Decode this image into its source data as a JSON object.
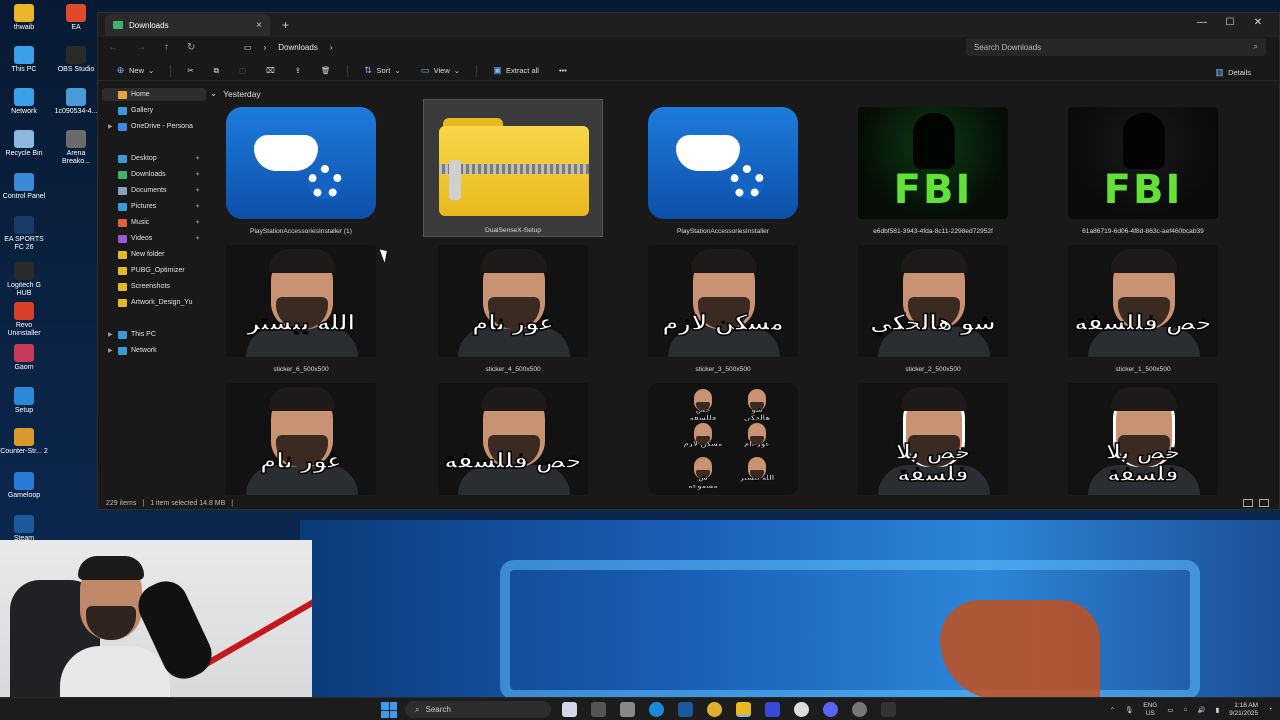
{
  "desktop": {
    "icons": [
      {
        "label": "thwaib",
        "color": "#e9b82a"
      },
      {
        "label": "EA",
        "color": "#e04a2a"
      },
      {
        "label": "This PC",
        "color": "#3aa0e8"
      },
      {
        "label": "OBS Studio",
        "color": "#2a2a2a"
      },
      {
        "label": "Network",
        "color": "#3aa0e8"
      },
      {
        "label": "1c090534-4...",
        "color": "#4a9ad8"
      },
      {
        "label": "Recycle Bin",
        "color": "#8fb8e0"
      },
      {
        "label": "Arena Breako...",
        "color": "#6a6a6a"
      },
      {
        "label": "Control Panel",
        "color": "#3a8ad8"
      },
      {
        "label": "EA SPORTS FC 26",
        "color": "#1a3a6a"
      },
      {
        "label": "Logitech G HUB",
        "color": "#2a2a2a"
      },
      {
        "label": "Revo Uninstaller",
        "color": "#d8402a"
      },
      {
        "label": "Gaom",
        "color": "#c83a5a"
      },
      {
        "label": "Setup",
        "color": "#2a8ad8"
      },
      {
        "label": "Counter-Str... 2",
        "color": "#d89a2a"
      },
      {
        "label": "Gameloop",
        "color": "#2a7ad8"
      },
      {
        "label": "Steam",
        "color": "#1a5a9a"
      }
    ]
  },
  "window": {
    "tab_title": "Downloads",
    "new_tab_icon": "plus-icon",
    "minimize": "—",
    "maximize": "☐",
    "close": "✕",
    "tab_close": "×"
  },
  "address": {
    "segments": [
      "Downloads"
    ],
    "search_placeholder": "Search Downloads"
  },
  "toolbar": {
    "new_label": "New",
    "sort_label": "Sort",
    "view_label": "View",
    "extract_label": "Extract all",
    "more_label": "•••",
    "details_label": "Details"
  },
  "sidebar": {
    "items": [
      {
        "label": "Home",
        "icon": "home-icon",
        "color": "#e0a83a"
      },
      {
        "label": "Gallery",
        "icon": "gallery-icon",
        "color": "#3a9ad8"
      },
      {
        "label": "OneDrive - Persona",
        "icon": "onedrive-icon",
        "color": "#3a8ae0"
      },
      {
        "label": "Desktop",
        "icon": "desktop-icon",
        "color": "#3a9ad8"
      },
      {
        "label": "Downloads",
        "icon": "downloads-icon",
        "color": "#3fb26a"
      },
      {
        "label": "Documents",
        "icon": "documents-icon",
        "color": "#8aa0c0"
      },
      {
        "label": "Pictures",
        "icon": "pictures-icon",
        "color": "#3a9ad8"
      },
      {
        "label": "Music",
        "icon": "music-icon",
        "color": "#e0603a"
      },
      {
        "label": "Videos",
        "icon": "videos-icon",
        "color": "#9a5ad8"
      },
      {
        "label": "New folder",
        "icon": "folder-icon",
        "color": "#e8b91e"
      },
      {
        "label": "PUBG_Optimizer",
        "icon": "folder-icon",
        "color": "#e8b91e"
      },
      {
        "label": "Screenshots",
        "icon": "folder-icon",
        "color": "#e8b91e"
      },
      {
        "label": "Artwork_Design_Yu",
        "icon": "folder-icon",
        "color": "#e8b91e"
      },
      {
        "label": "This PC",
        "icon": "this-pc-icon",
        "color": "#3a9ad8"
      },
      {
        "label": "Network",
        "icon": "network-icon",
        "color": "#3a9ad8"
      }
    ]
  },
  "content": {
    "group_label": "Yesterday",
    "files": [
      {
        "name": "PlayStationAccessoriesInstaller (1)",
        "kind": "ps"
      },
      {
        "name": "DualSenseX-Setup",
        "kind": "zip"
      },
      {
        "name": "PlayStationAccessoriesInstaller",
        "kind": "ps"
      },
      {
        "name": "e6dbf581-3943-4fda-8c11-2298ed72952f",
        "kind": "fbi",
        "text": "FBI"
      },
      {
        "name": "61a86719-6d06-4f8d-863c-aef460bcab39",
        "kind": "fbi-dark",
        "text": "FBI"
      },
      {
        "name": "sticker_6_500x500",
        "kind": "face",
        "text": "الله ييستر"
      },
      {
        "name": "sticker_4_500x500",
        "kind": "face",
        "text": "غور نام"
      },
      {
        "name": "sticker_3_500x500",
        "kind": "face",
        "text": "مسكن لازم"
      },
      {
        "name": "sticker_2_500x500",
        "kind": "face",
        "text": "شو هالحكي"
      },
      {
        "name": "sticker_1_500x500",
        "kind": "face",
        "text": "خص فللسفة"
      },
      {
        "name": "",
        "kind": "face",
        "text": "غور نام"
      },
      {
        "name": "",
        "kind": "face",
        "text": "خص فللسفة"
      },
      {
        "name": "",
        "kind": "grid",
        "minis": [
          "خص فللسفة",
          "شو هالحكي",
          "مسكن لازم",
          "غور نام",
          "ش مسموعة",
          "الله ييستر"
        ]
      },
      {
        "name": "",
        "kind": "face-outline",
        "text": "خص بلا فلسفة"
      },
      {
        "name": "",
        "kind": "face-outline",
        "text": "خص بلا فلسفة"
      }
    ]
  },
  "statusbar": {
    "items_count": "229 items",
    "selection": "1 item selected  14.8 MB"
  },
  "taskbar": {
    "search_label": "Search",
    "language": "ENG",
    "region": "US",
    "time": "1:18 AM",
    "date": "9/21/2025"
  }
}
